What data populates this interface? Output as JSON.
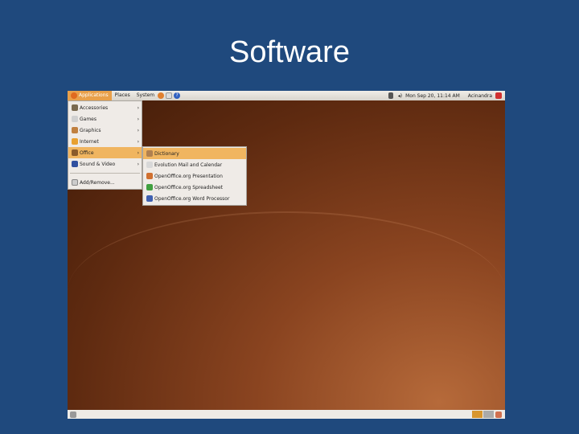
{
  "slide_title": "Software",
  "top_panel": {
    "menus": [
      "Applications",
      "Places",
      "System"
    ],
    "clock": "Mon Sep 20, 11:14 AM",
    "user": "Acinandra"
  },
  "applications_menu": [
    {
      "label": "Accessories",
      "icon": "accessories-icon",
      "color": "#7a6a50"
    },
    {
      "label": "Games",
      "icon": "games-icon",
      "color": "#d0d0d0"
    },
    {
      "label": "Graphics",
      "icon": "graphics-icon",
      "color": "#c08040"
    },
    {
      "label": "Internet",
      "icon": "internet-icon",
      "color": "#e8a030"
    },
    {
      "label": "Office",
      "icon": "office-icon",
      "color": "#8a5a2a"
    },
    {
      "label": "Sound & Video",
      "icon": "sound-video-icon",
      "color": "#3050a0"
    }
  ],
  "add_remove": "Add/Remove...",
  "office_submenu": [
    {
      "label": "Dictionary",
      "icon": "dictionary-icon",
      "color": "#b08050"
    },
    {
      "label": "Evolution Mail and Calendar",
      "icon": "mail-icon",
      "color": "#d8d8d8"
    },
    {
      "label": "OpenOffice.org Presentation",
      "icon": "presentation-icon",
      "color": "#d07030"
    },
    {
      "label": "OpenOffice.org Spreadsheet",
      "icon": "spreadsheet-icon",
      "color": "#40a040"
    },
    {
      "label": "OpenOffice.org Word Processor",
      "icon": "word-processor-icon",
      "color": "#4060b0"
    }
  ],
  "colors": {
    "highlight": "#f0b560",
    "slide_bg": "#1f497d"
  }
}
